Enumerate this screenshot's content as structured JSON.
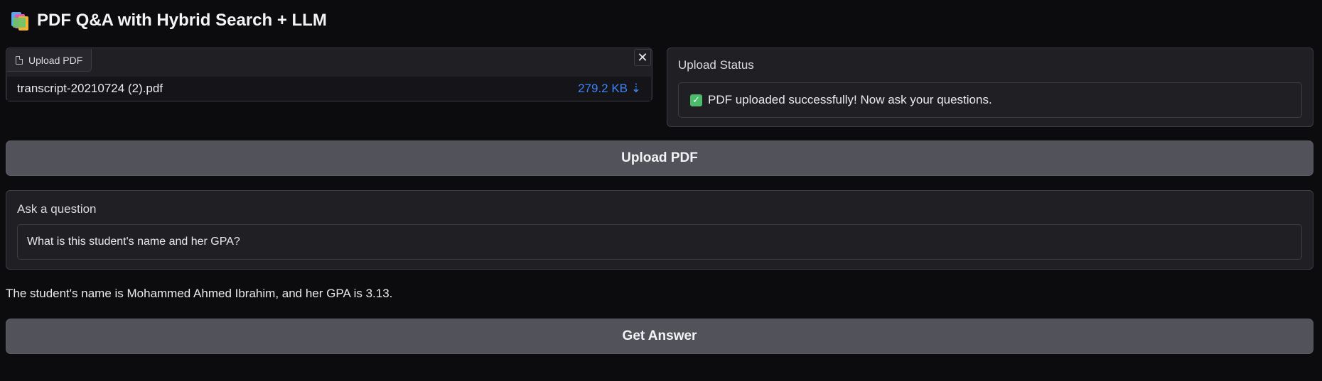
{
  "app": {
    "title": "PDF Q&A with Hybrid Search + LLM",
    "title_icon": "books-icon"
  },
  "file_upload": {
    "tab_label": "Upload PDF",
    "tab_icon": "file-icon",
    "close_icon": "close-icon",
    "file_name": "transcript-20210724 (2).pdf",
    "file_size": "279.2 KB ⇣",
    "file_size_color": "#3d82f6"
  },
  "upload_status": {
    "label": "Upload Status",
    "check_icon": "checkmark-icon",
    "check_color": "#4cbb6c",
    "message": "PDF uploaded successfully! Now ask your questions."
  },
  "upload_button": {
    "label": "Upload PDF"
  },
  "question": {
    "label": "Ask a question",
    "value": "What is this student's name and her GPA?"
  },
  "answer": {
    "text": "The student's name is Mohammed Ahmed Ibrahim, and her GPA is 3.13."
  },
  "answer_button": {
    "label": "Get Answer"
  },
  "colors": {
    "background": "#0c0c0f",
    "panel": "#1f1f24",
    "button": "#52525b"
  }
}
